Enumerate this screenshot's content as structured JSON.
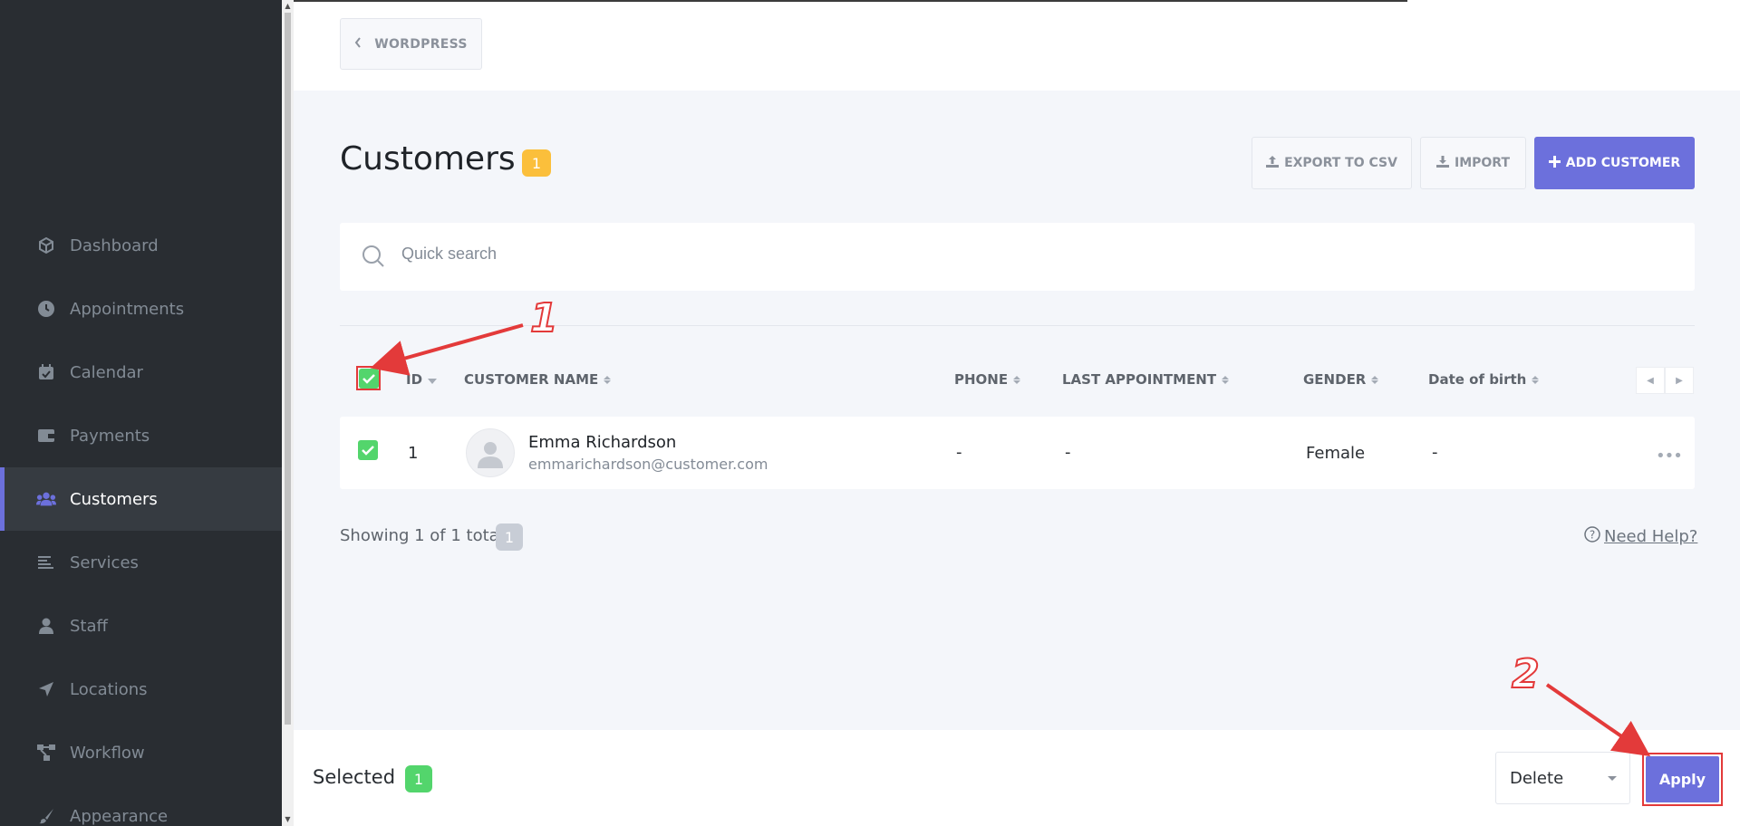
{
  "sidebar": {
    "items": [
      {
        "label": "Dashboard",
        "icon": "cube-icon"
      },
      {
        "label": "Appointments",
        "icon": "clock-icon"
      },
      {
        "label": "Calendar",
        "icon": "calendar-icon"
      },
      {
        "label": "Payments",
        "icon": "wallet-icon"
      },
      {
        "label": "Customers",
        "icon": "users-icon",
        "active": true
      },
      {
        "label": "Services",
        "icon": "list-icon"
      },
      {
        "label": "Staff",
        "icon": "user-icon"
      },
      {
        "label": "Locations",
        "icon": "location-arrow-icon"
      },
      {
        "label": "Workflow",
        "icon": "workflow-icon"
      },
      {
        "label": "Appearance",
        "icon": "brush-icon"
      }
    ]
  },
  "header": {
    "back_label": "WORDPRESS",
    "title": "Customers",
    "count": "1",
    "export_label": "EXPORT TO CSV",
    "import_label": "IMPORT",
    "add_label": "ADD CUSTOMER"
  },
  "search": {
    "placeholder": "Quick search"
  },
  "table": {
    "columns": [
      "ID",
      "CUSTOMER NAME",
      "PHONE",
      "LAST APPOINTMENT",
      "GENDER",
      "Date of birth"
    ],
    "rows": [
      {
        "id": "1",
        "name": "Emma Richardson",
        "email": "emmarichardson@customer.com",
        "phone": "-",
        "last_appointment": "-",
        "gender": "Female",
        "dob": "-"
      }
    ]
  },
  "footer": {
    "showing": "Showing 1 of 1 total",
    "showing_count": "1",
    "help": "Need Help?"
  },
  "bulk": {
    "selected_label": "Selected",
    "selected_count": "1",
    "action_value": "Delete",
    "apply_label": "Apply"
  },
  "annotations": {
    "step1": "1",
    "step2": "2"
  },
  "colors": {
    "accent": "#6c70dc",
    "sidebar_bg": "#292d32",
    "check_green": "#53d56c",
    "badge_yellow": "#fbbf3b",
    "annotation_red": "#e33a3a"
  }
}
